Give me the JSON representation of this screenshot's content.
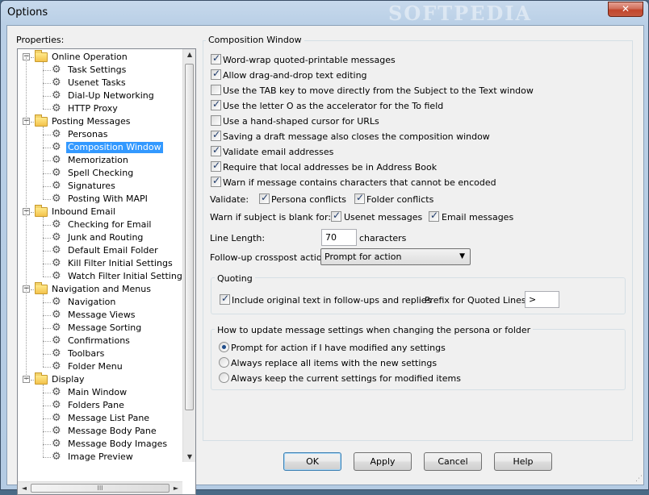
{
  "window": {
    "title": "Options",
    "watermark": "SOFTPEDIA",
    "close_icon": "close-icon"
  },
  "tree": {
    "label": "Properties:",
    "items": [
      {
        "label": "Online Operation",
        "type": "folder",
        "level": 0,
        "expanded": true
      },
      {
        "label": "Task Settings",
        "type": "gear",
        "level": 1
      },
      {
        "label": "Usenet Tasks",
        "type": "gear",
        "level": 1
      },
      {
        "label": "Dial-Up Networking",
        "type": "gear",
        "level": 1
      },
      {
        "label": "HTTP Proxy",
        "type": "gear",
        "level": 1
      },
      {
        "label": "Posting Messages",
        "type": "folder",
        "level": 0,
        "expanded": true
      },
      {
        "label": "Personas",
        "type": "gear",
        "level": 1
      },
      {
        "label": "Composition Window",
        "type": "gear",
        "level": 1,
        "selected": true
      },
      {
        "label": "Memorization",
        "type": "gear",
        "level": 1
      },
      {
        "label": "Spell Checking",
        "type": "gear",
        "level": 1
      },
      {
        "label": "Signatures",
        "type": "gear",
        "level": 1
      },
      {
        "label": "Posting With MAPI",
        "type": "gear",
        "level": 1
      },
      {
        "label": "Inbound Email",
        "type": "folder",
        "level": 0,
        "expanded": true
      },
      {
        "label": "Checking for Email",
        "type": "gear",
        "level": 1
      },
      {
        "label": "Junk and Routing",
        "type": "gear",
        "level": 1
      },
      {
        "label": "Default Email Folder",
        "type": "gear",
        "level": 1
      },
      {
        "label": "Kill Filter Initial Settings",
        "type": "gear",
        "level": 1
      },
      {
        "label": "Watch Filter Initial Settings",
        "type": "gear",
        "level": 1
      },
      {
        "label": "Navigation and Menus",
        "type": "folder",
        "level": 0,
        "expanded": true
      },
      {
        "label": "Navigation",
        "type": "gear",
        "level": 1
      },
      {
        "label": "Message Views",
        "type": "gear",
        "level": 1
      },
      {
        "label": "Message Sorting",
        "type": "gear",
        "level": 1
      },
      {
        "label": "Confirmations",
        "type": "gear",
        "level": 1
      },
      {
        "label": "Toolbars",
        "type": "gear",
        "level": 1
      },
      {
        "label": "Folder Menu",
        "type": "gear",
        "level": 1
      },
      {
        "label": "Display",
        "type": "folder",
        "level": 0,
        "expanded": true
      },
      {
        "label": "Main Window",
        "type": "gear",
        "level": 1
      },
      {
        "label": "Folders Pane",
        "type": "gear",
        "level": 1
      },
      {
        "label": "Message List Pane",
        "type": "gear",
        "level": 1
      },
      {
        "label": "Message Body Pane",
        "type": "gear",
        "level": 1
      },
      {
        "label": "Message Body Images",
        "type": "gear",
        "level": 1
      },
      {
        "label": "Image Preview",
        "type": "gear",
        "level": 1
      }
    ],
    "expand_glyph": "−",
    "scroll_up": "▲",
    "scroll_down": "▼",
    "scroll_left": "◄",
    "scroll_right": "►",
    "scroll_grip": "III"
  },
  "composition": {
    "group_title": "Composition Window",
    "checkboxes": [
      {
        "label": "Word-wrap quoted-printable messages",
        "checked": true
      },
      {
        "label": "Allow drag-and-drop text editing",
        "checked": true
      },
      {
        "label": "Use the TAB key to move directly from the Subject to the Text window",
        "checked": false
      },
      {
        "label": "Use the letter O as the accelerator for the To field",
        "checked": true
      },
      {
        "label": "Use a hand-shaped cursor for URLs",
        "checked": false
      },
      {
        "label": "Saving a draft message also closes the composition window",
        "checked": true
      },
      {
        "label": "Validate email addresses",
        "checked": true
      },
      {
        "label": "Require that local addresses be in Address Book",
        "checked": true
      },
      {
        "label": "Warn if message contains characters that cannot be encoded",
        "checked": true
      }
    ],
    "validate_label": "Validate:",
    "persona_conflicts": {
      "label": "Persona conflicts",
      "checked": true
    },
    "folder_conflicts": {
      "label": "Folder conflicts",
      "checked": true
    },
    "warn_blank_label": "Warn if subject is blank for:",
    "usenet_messages": {
      "label": "Usenet messages",
      "checked": true
    },
    "email_messages": {
      "label": "Email messages",
      "checked": true
    },
    "line_length_label": "Line Length:",
    "line_length_value": "70",
    "characters_label": "characters",
    "followup_label": "Follow-up crosspost action:",
    "followup_value": "Prompt for action",
    "followup_arrow": "▼"
  },
  "quoting": {
    "title": "Quoting",
    "include_original": {
      "label": "Include original text in follow-ups and replies",
      "checked": true
    },
    "prefix_label": "Prefix for Quoted Lines:",
    "prefix_value": ">"
  },
  "persona_update": {
    "title": "How to update message settings when changing the persona or folder",
    "options": [
      {
        "label": "Prompt for action if I have modified any settings",
        "selected": true
      },
      {
        "label": "Always replace all items with the new settings",
        "selected": false
      },
      {
        "label": "Always keep the current settings for modified items",
        "selected": false
      }
    ]
  },
  "buttons": {
    "ok": "OK",
    "apply": "Apply",
    "cancel": "Cancel",
    "help": "Help"
  }
}
